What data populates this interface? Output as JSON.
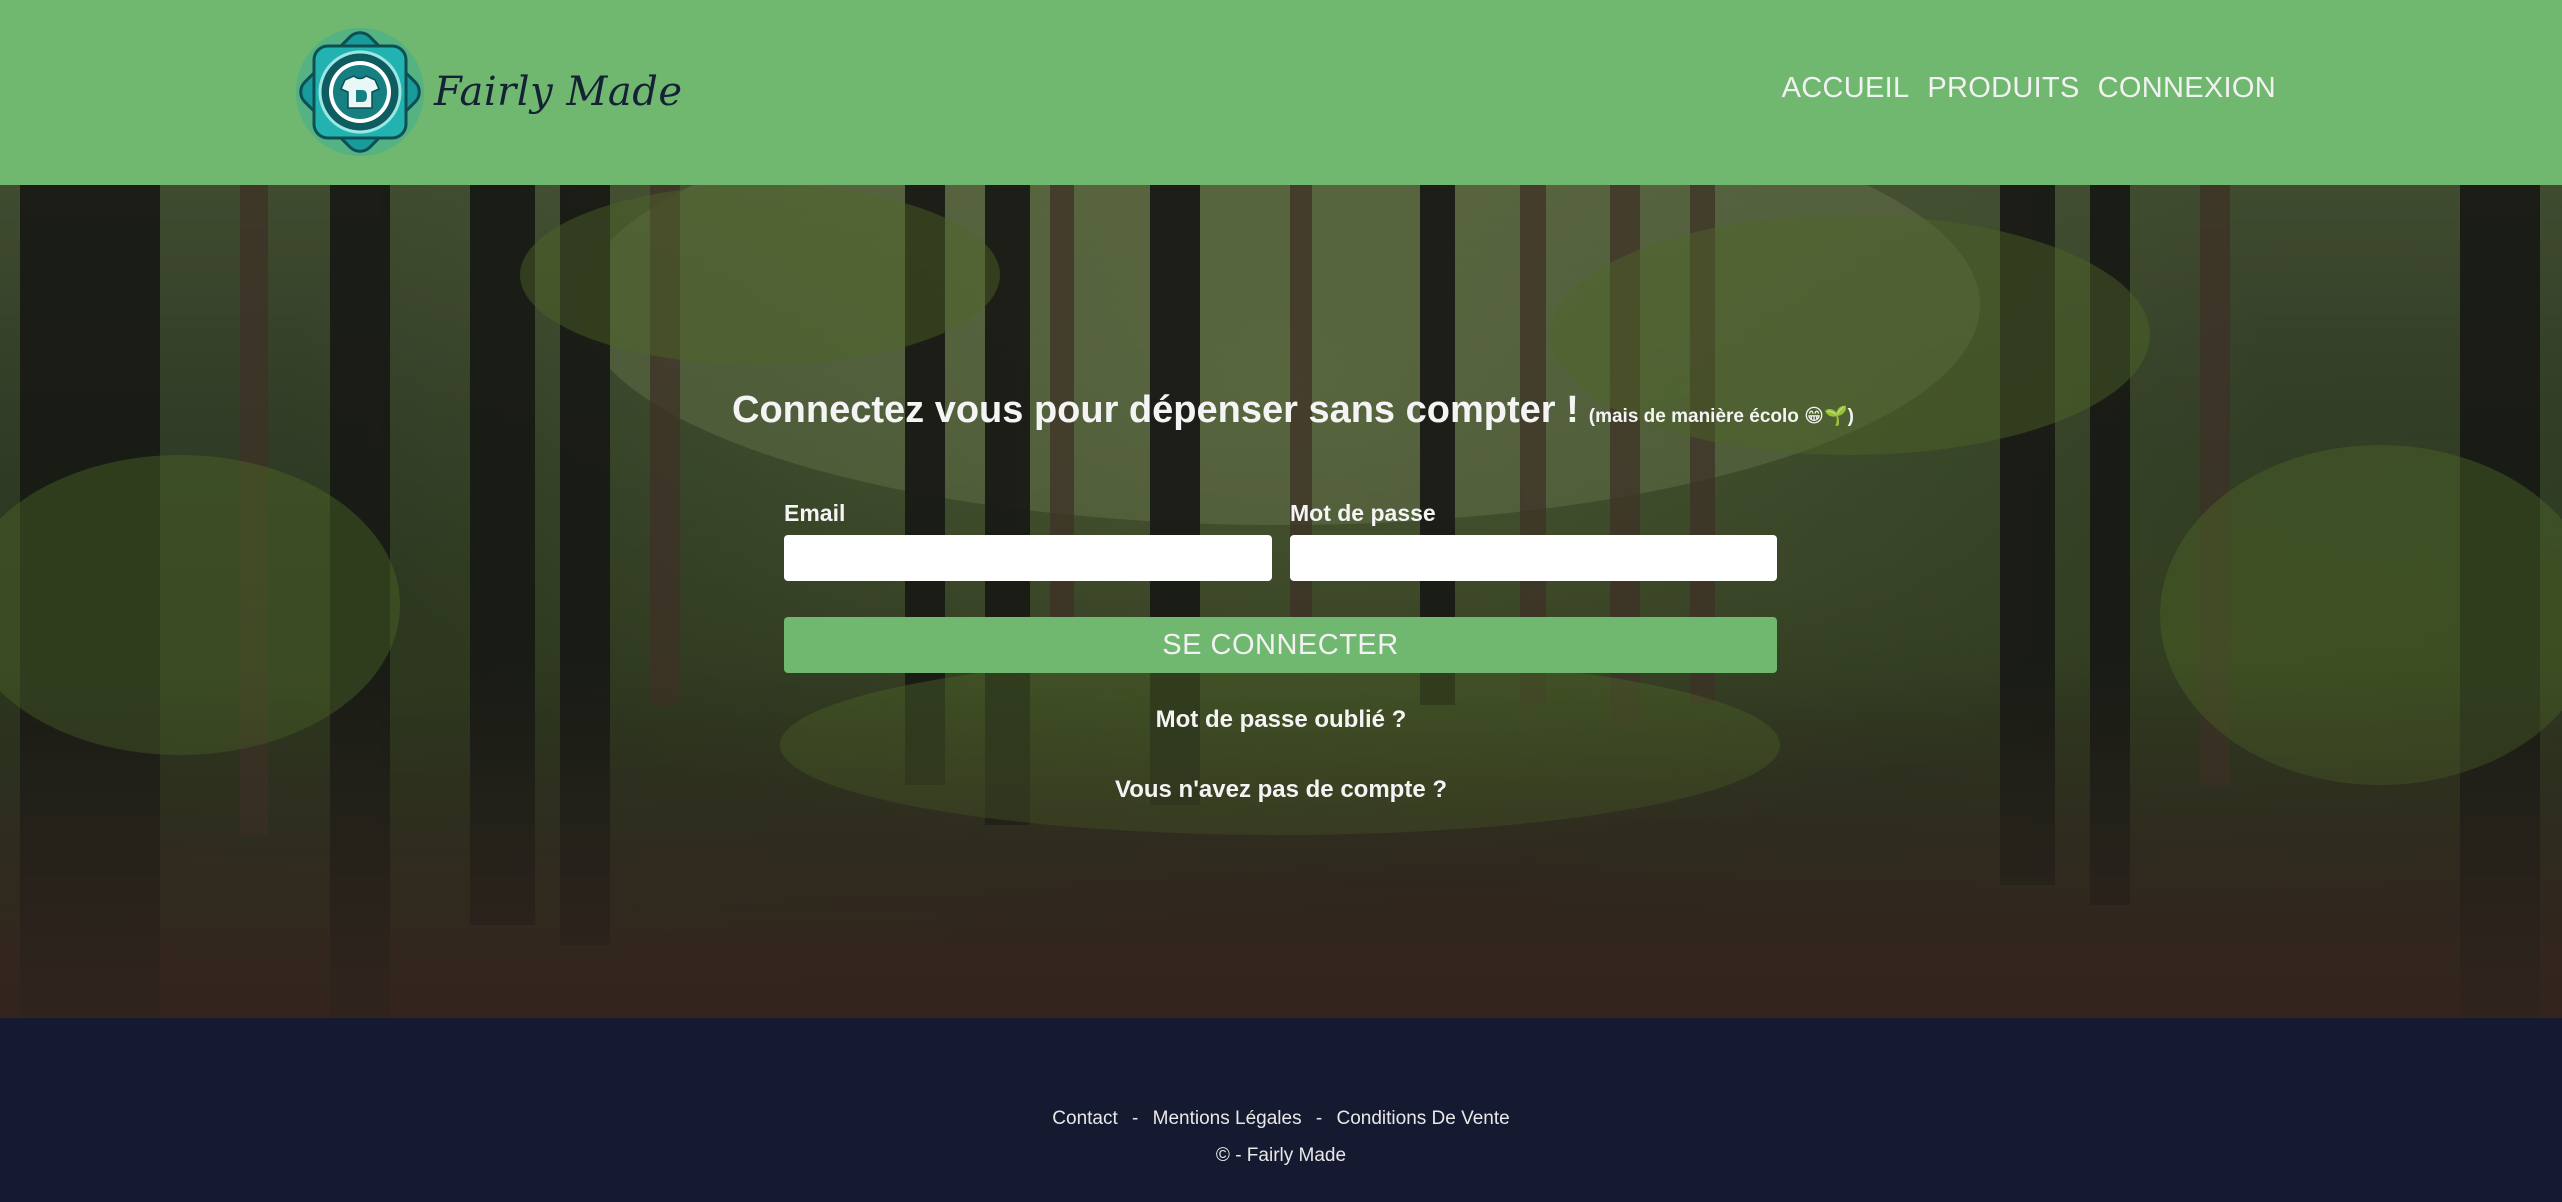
{
  "header": {
    "brand": "Fairly Made",
    "logo_icon": "tshirt-emblem-icon",
    "nav": [
      {
        "label": "ACCUEIL"
      },
      {
        "label": "PRODUITS"
      },
      {
        "label": "CONNEXION"
      }
    ]
  },
  "login": {
    "title": "Connectez vous pour dépenser sans compter !",
    "title_note": "(mais de manière écolo 😁🌱)",
    "email_label": "Email",
    "email_value": "",
    "password_label": "Mot de passe",
    "password_value": "",
    "submit_label": "SE CONNECTER",
    "forgot_label": "Mot de passe oublié ?",
    "signup_label": "Vous n'avez pas de compte ?"
  },
  "footer": {
    "links": [
      {
        "label": "Contact"
      },
      {
        "label": "Mentions Légales"
      },
      {
        "label": "Conditions De Vente"
      }
    ],
    "separator": "-",
    "copyright": "© - Fairly Made"
  },
  "colors": {
    "header_bg": "#70b76f",
    "button_bg": "#70b76f",
    "footer_bg": "#161a30",
    "logo_teal": "#1fa9a8"
  }
}
